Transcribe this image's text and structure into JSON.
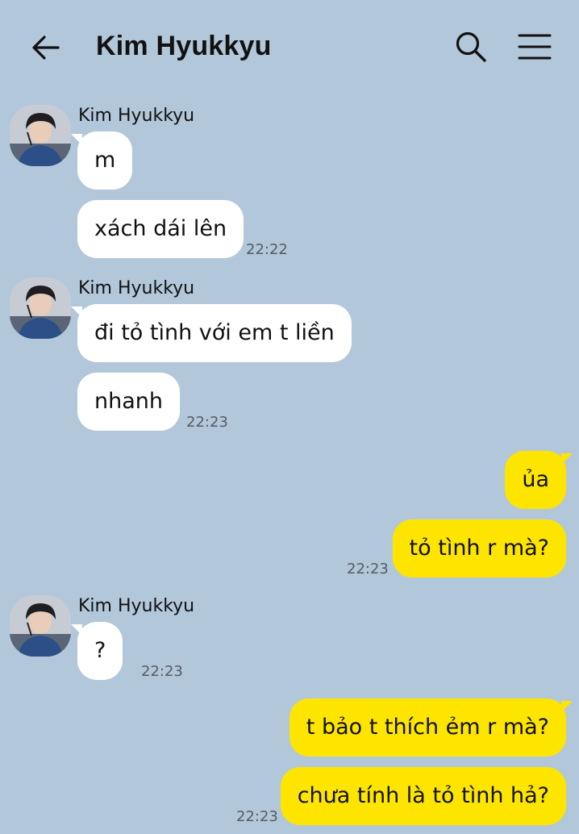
{
  "header": {
    "title": "Kim Hyukkyu"
  },
  "icons": {
    "back": "arrow-left-icon",
    "search": "magnifier-icon",
    "menu": "hamburger-menu-icon"
  },
  "colors": {
    "background": "#b2c7da",
    "incoming_bubble": "#ffffff",
    "outgoing_bubble": "#fee500"
  },
  "groups": [
    {
      "sender": "Kim Hyukkyu",
      "messages": [
        "m",
        "xách dái lên"
      ],
      "time": "22:22"
    },
    {
      "sender": "Kim Hyukkyu",
      "messages": [
        "đi tỏ tình với em t liền",
        "nhanh"
      ],
      "time": "22:23"
    },
    {
      "messages": [
        "ủa",
        "tỏ tình r mà?"
      ],
      "time": "22:23"
    },
    {
      "sender": "Kim Hyukkyu",
      "messages": [
        "?"
      ],
      "time": "22:23"
    },
    {
      "messages": [
        "t bảo t thích ẻm r mà?",
        "chưa tính là tỏ tình hả?"
      ],
      "time": "22:23"
    }
  ]
}
